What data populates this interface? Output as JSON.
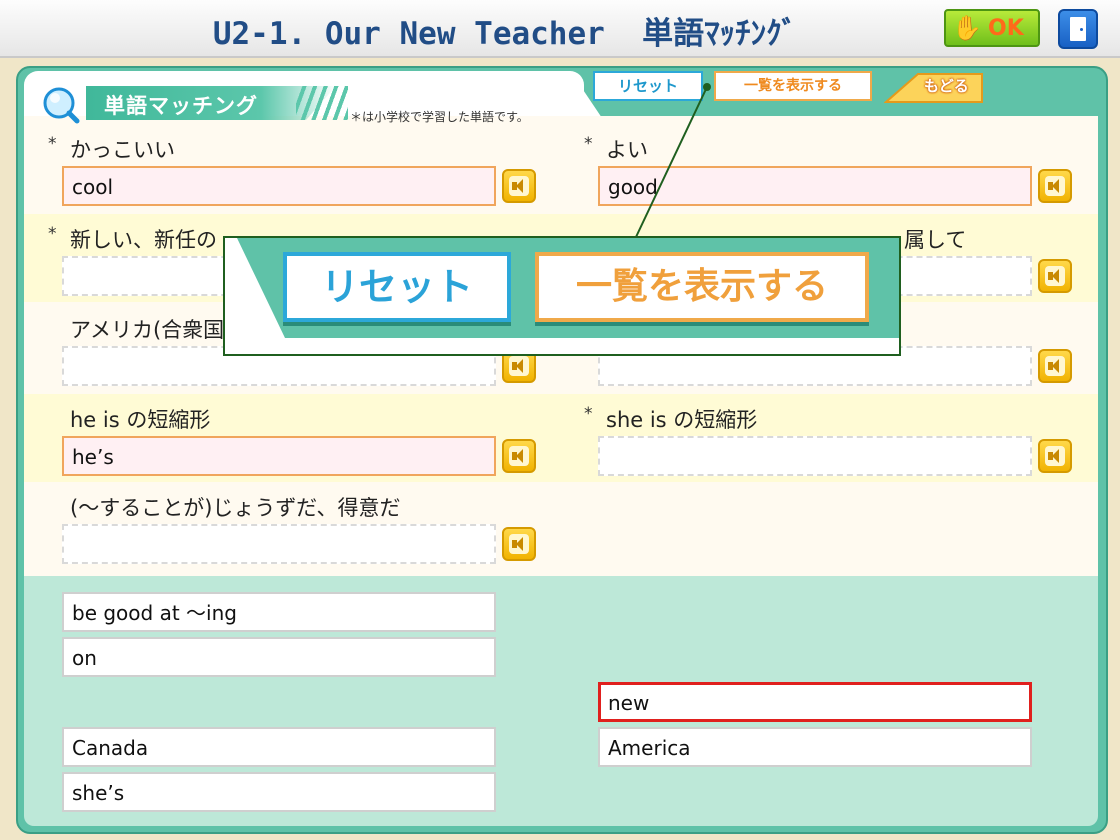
{
  "header": {
    "title": "U2-1. Our New Teacher  単語ﾏｯﾁﾝｸﾞ",
    "ok_label": "OK",
    "ok_icon": "ok-hand-icon",
    "exit_icon": "exit-door-icon"
  },
  "toolbar": {
    "section_title": "単語マッチング",
    "note": "＊は小学校で学習した単語です。",
    "reset_label": "リセット",
    "list_label": "一覧を表示する",
    "back_label": "もどる"
  },
  "questions": [
    {
      "star": "*",
      "label": "かっこいい",
      "answer": "cool"
    },
    {
      "star": "*",
      "label": "よい",
      "answer": "good"
    },
    {
      "star": "*",
      "label": "新しい、新任の",
      "answer": ""
    },
    {
      "star": "",
      "label": "属して",
      "answer": ""
    },
    {
      "star": "",
      "label": "アメリカ(合衆国",
      "answer": ""
    },
    {
      "star": "",
      "label": "",
      "answer": ""
    },
    {
      "star": "",
      "label": "he is の短縮形",
      "answer": "he’s"
    },
    {
      "star": "*",
      "label": "she is の短縮形",
      "answer": ""
    },
    {
      "star": "",
      "label": "(〜することが)じょうずだ、得意だ",
      "answer": ""
    }
  ],
  "cards": [
    {
      "text": "be good at 〜ing"
    },
    {
      "text": "on"
    },
    {
      "text": "new"
    },
    {
      "text": "Canada"
    },
    {
      "text": "America"
    },
    {
      "text": "she’s"
    }
  ],
  "callout": {
    "reset_label": "リセット",
    "list_label": "一覧を表示する"
  },
  "colors": {
    "panel": "#5fc2a8",
    "title": "#214d86",
    "reset_accent": "#2ca8d9",
    "list_accent": "#f0a94a",
    "selected_card_border": "#e0201e"
  }
}
